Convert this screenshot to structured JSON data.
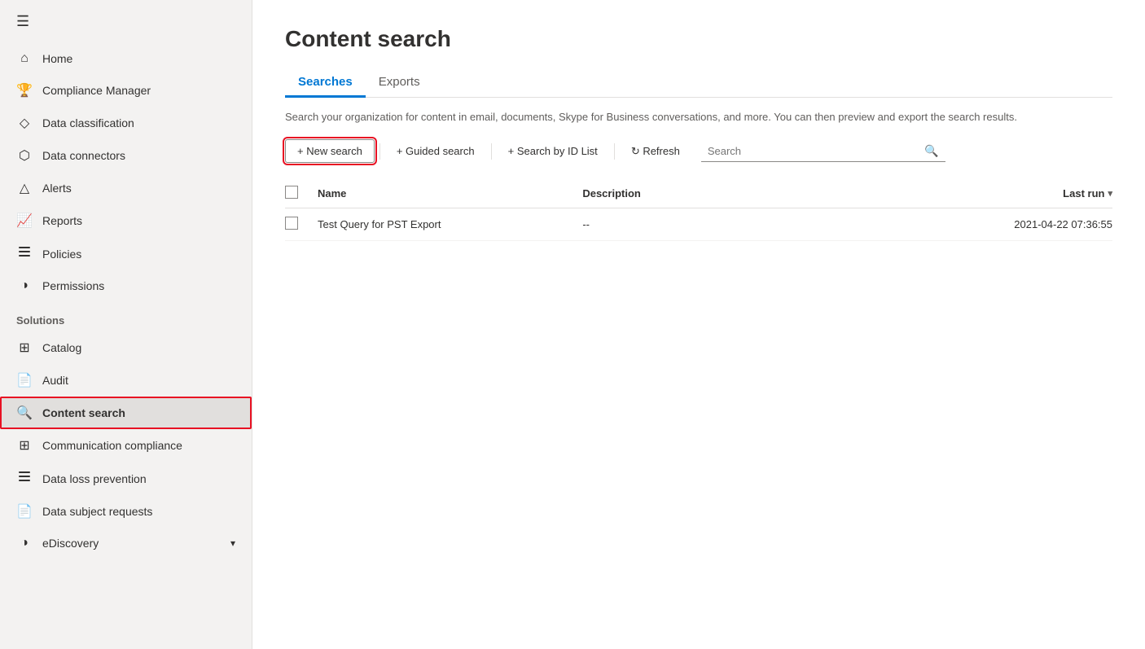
{
  "sidebar": {
    "hamburger": "☰",
    "nav_items": [
      {
        "id": "home",
        "icon": "⌂",
        "label": "Home",
        "active": false
      },
      {
        "id": "compliance-manager",
        "icon": "🏆",
        "label": "Compliance Manager",
        "active": false
      },
      {
        "id": "data-classification",
        "icon": "◇",
        "label": "Data classification",
        "active": false
      },
      {
        "id": "data-connectors",
        "icon": "⬡",
        "label": "Data connectors",
        "active": false
      },
      {
        "id": "alerts",
        "icon": "△",
        "label": "Alerts",
        "active": false
      },
      {
        "id": "reports",
        "icon": "📈",
        "label": "Reports",
        "active": false
      },
      {
        "id": "policies",
        "icon": "☰",
        "label": "Policies",
        "active": false
      },
      {
        "id": "permissions",
        "icon": "◑",
        "label": "Permissions",
        "active": false
      }
    ],
    "solutions_label": "Solutions",
    "solutions_items": [
      {
        "id": "catalog",
        "icon": "⊞",
        "label": "Catalog",
        "active": false
      },
      {
        "id": "audit",
        "icon": "📄",
        "label": "Audit",
        "active": false
      },
      {
        "id": "content-search",
        "icon": "🔍",
        "label": "Content search",
        "active": true
      },
      {
        "id": "communication-compliance",
        "icon": "⊞",
        "label": "Communication compliance",
        "active": false
      },
      {
        "id": "data-loss-prevention",
        "icon": "☰",
        "label": "Data loss prevention",
        "active": false
      },
      {
        "id": "data-subject-requests",
        "icon": "📄",
        "label": "Data subject requests",
        "active": false
      },
      {
        "id": "ediscovery",
        "icon": "◑",
        "label": "eDiscovery",
        "active": false,
        "has_chevron": true
      }
    ]
  },
  "main": {
    "page_title": "Content search",
    "tabs": [
      {
        "id": "searches",
        "label": "Searches",
        "active": true
      },
      {
        "id": "exports",
        "label": "Exports",
        "active": false
      }
    ],
    "description": "Search your organization for content in email, documents, Skype for Business conversations, and more. You can then preview and export the search results.",
    "toolbar": {
      "new_search_label": "+ New search",
      "guided_search_label": "+ Guided search",
      "search_by_id_label": "+ Search by ID List",
      "refresh_label": "↻ Refresh",
      "search_placeholder": "Search"
    },
    "table": {
      "col_name": "Name",
      "col_desc": "Description",
      "col_lastrun": "Last run",
      "rows": [
        {
          "id": "row1",
          "name": "Test Query for PST Export",
          "description": "--",
          "last_run": "2021-04-22 07:36:55"
        }
      ]
    }
  }
}
